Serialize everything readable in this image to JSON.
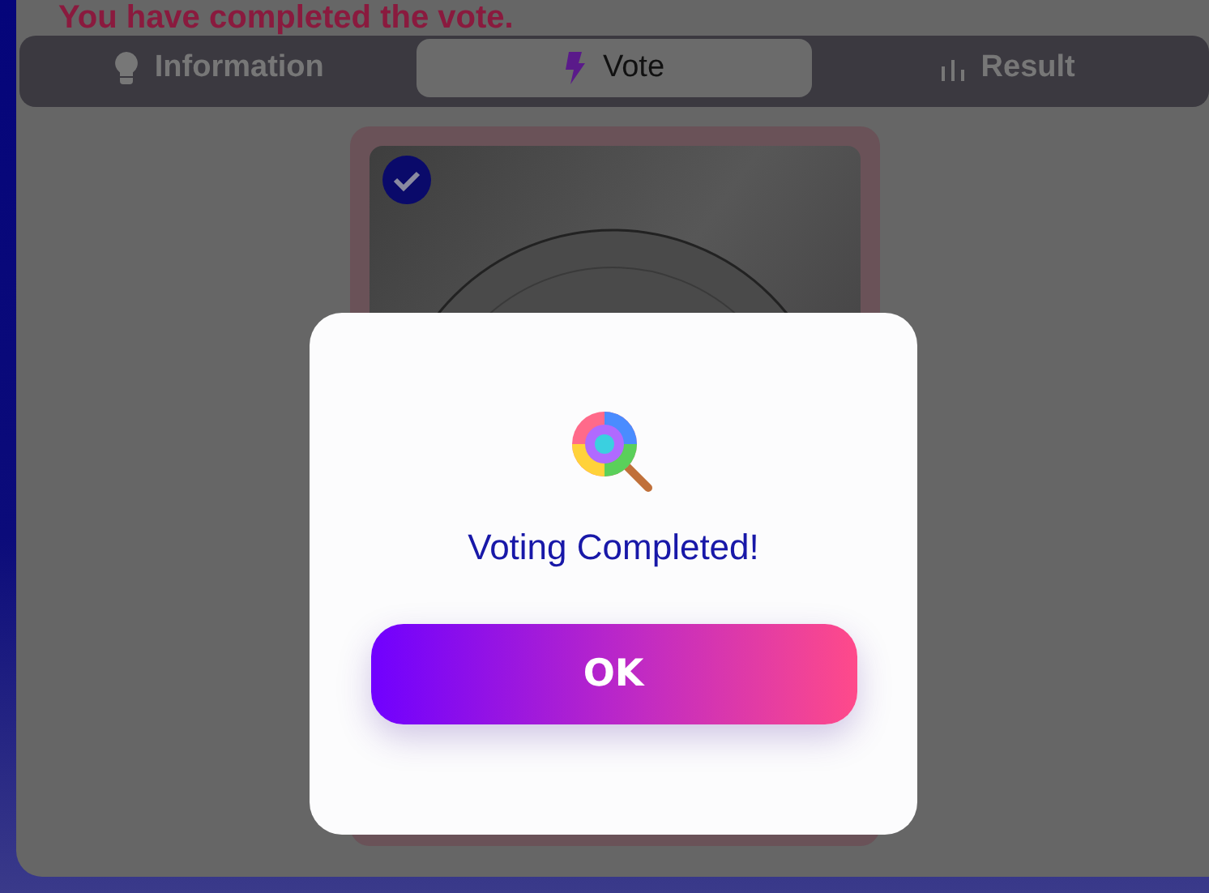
{
  "headline": "You have completed the vote.",
  "tabs": [
    {
      "label": "Information",
      "kind": "info",
      "selected": false
    },
    {
      "label": "Vote",
      "kind": "vote",
      "selected": true
    },
    {
      "label": "Result",
      "kind": "result",
      "selected": false
    }
  ],
  "candidate": {
    "kind": "picture",
    "checked": true
  },
  "dialog": {
    "message": "Voting Completed!",
    "button": "OK"
  }
}
